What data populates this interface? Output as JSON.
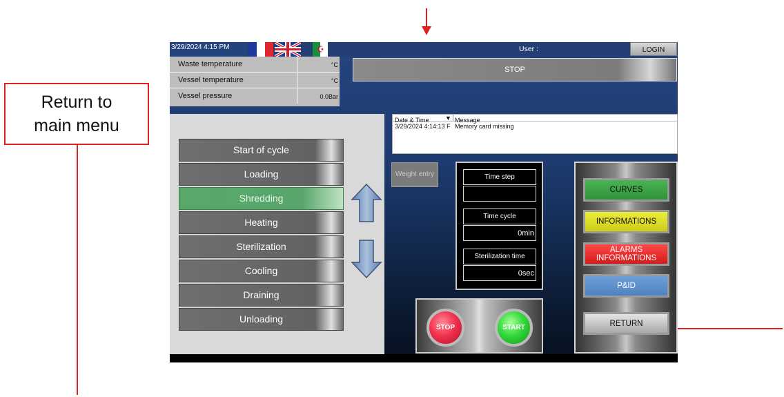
{
  "annotation": {
    "callout_text": "Return to\nmain menu",
    "color": "#e02020"
  },
  "header": {
    "datetime": "3/29/2024 4:15 PM",
    "user_label": "User :",
    "login_label": "LOGIN",
    "status": "STOP",
    "flags": [
      "flag-fr-icon",
      "flag-uk-icon",
      "flag-dz-icon"
    ]
  },
  "readings": [
    {
      "label": "Waste temperature",
      "value": "°C"
    },
    {
      "label": "Vessel temperature",
      "value": "°C"
    },
    {
      "label": "Vessel pressure",
      "value": "0.0Bar"
    }
  ],
  "steps": [
    {
      "label": "Start of cycle",
      "active": false
    },
    {
      "label": "Loading",
      "active": false
    },
    {
      "label": "Shredding",
      "active": true
    },
    {
      "label": "Heating",
      "active": false
    },
    {
      "label": "Sterilization",
      "active": false
    },
    {
      "label": "Cooling",
      "active": false
    },
    {
      "label": "Draining",
      "active": false
    },
    {
      "label": "Unloading",
      "active": false
    }
  ],
  "messages": {
    "columns": [
      "Date & Time",
      "Message"
    ],
    "rows": [
      {
        "datetime": "3/29/2024 4:14:13 F",
        "message": "Memory card missing"
      }
    ]
  },
  "weight_entry_label": "Weight entry",
  "timers": {
    "time_step_label": "Time step",
    "time_step_value": "",
    "time_cycle_label": "Time cycle",
    "time_cycle_value": "0min",
    "sterilization_label": "Sterilization time",
    "sterilization_value": "0sec"
  },
  "controls": {
    "stop_label": "STOP",
    "start_label": "START"
  },
  "menu": {
    "curves": "CURVES",
    "informations": "INFORMATIONS",
    "alarms": "ALARMS\nINFORMATIONS",
    "pid": "P&ID",
    "return": "RETURN"
  },
  "colors": {
    "hmi_blue": "#24447c",
    "active_step": "#58a86a",
    "curves": "#3aa445",
    "informations": "#e0e02a",
    "alarms": "#e83030",
    "pid": "#5f92cc"
  }
}
